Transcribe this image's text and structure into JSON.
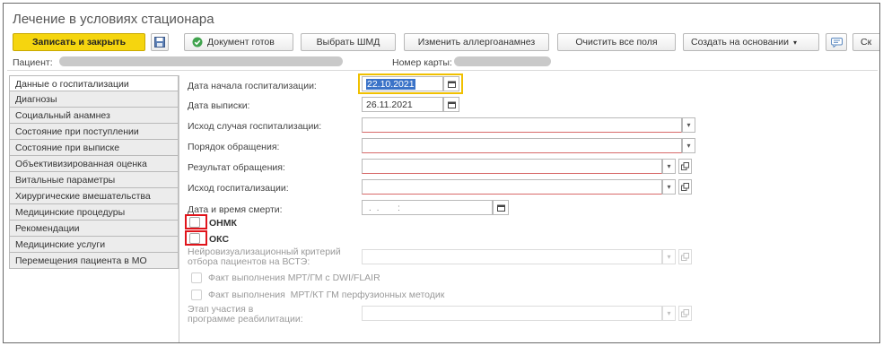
{
  "window": {
    "title": "Лечение в условиях стационара"
  },
  "toolbar": {
    "save_close": "Записать и закрыть",
    "doc_ready": "Документ готов",
    "choose_shmd": "Выбрать ШМД",
    "change_allergy": "Изменить аллергоанамнез",
    "clear_fields": "Очистить все поля",
    "create_based": "Создать на основании",
    "more": "Ск"
  },
  "patient": {
    "patient_label": "Пациент:",
    "card_label": "Номер карты:"
  },
  "sidebar": {
    "items": [
      {
        "label": "Данные о госпитализации",
        "active": true
      },
      {
        "label": "Диагнозы"
      },
      {
        "label": "Социальный анамнез"
      },
      {
        "label": "Состояние при поступлении"
      },
      {
        "label": "Состояние при выписке"
      },
      {
        "label": "Объективизированная оценка"
      },
      {
        "label": "Витальные параметры"
      },
      {
        "label": "Хирургические вмешательства"
      },
      {
        "label": "Медицинские процедуры"
      },
      {
        "label": "Рекомендации"
      },
      {
        "label": "Медицинские услуги"
      },
      {
        "label": "Перемещения пациента в МО"
      }
    ]
  },
  "form": {
    "admission_date": {
      "label": "Дата начала госпитализации:",
      "value": "22.10.2021"
    },
    "discharge_date": {
      "label": "Дата выписки:",
      "value": "26.11.2021"
    },
    "hosp_outcome_case": {
      "label": "Исход случая госпитализации:",
      "value": ""
    },
    "referral_order": {
      "label": "Порядок обращения:",
      "value": ""
    },
    "referral_result": {
      "label": "Результат обращения:",
      "value": ""
    },
    "hosp_outcome": {
      "label": "Исход госпитализации:",
      "value": ""
    },
    "death_datetime": {
      "label": "Дата и время смерти:",
      "value": " .  .       :"
    },
    "onmk": {
      "label": "ОНМК",
      "checked": false
    },
    "oks": {
      "label": "ОКС",
      "checked": false
    },
    "neuro_criterion": {
      "label_line1": "Нейровизуализационный критерий",
      "label_line2": "отбора пациентов на ВСТЭ:"
    },
    "mri_dwi": {
      "label": "Факт выполнения МРТ/ГМ с DWI/FLAIR",
      "checked": false
    },
    "mri_ct_perf": {
      "label": "Факт выполнения  МРТ/КТ ГМ перфузионных методик",
      "checked": false
    },
    "rehab_stage": {
      "label_line1": "Этап участия в",
      "label_line2": "программе реабилитации:"
    }
  },
  "colors": {
    "primary_button": "#f5d50f",
    "highlight_red": "#e0141b",
    "highlight_yellow": "#f0c000",
    "required_underline": "#d86a6a"
  }
}
